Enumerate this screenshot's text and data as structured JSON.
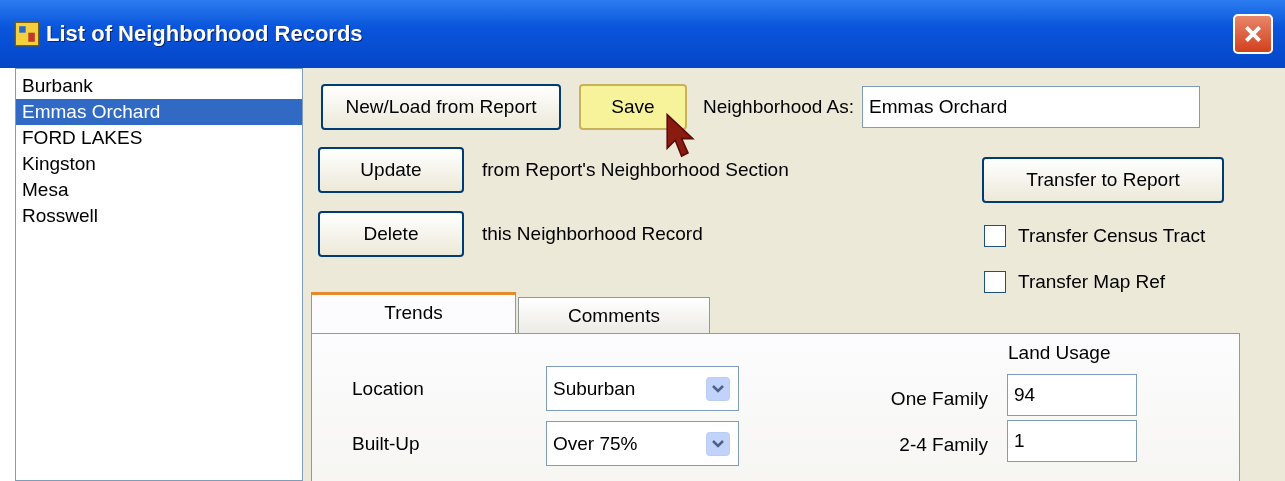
{
  "window": {
    "title": "List of Neighborhood Records"
  },
  "neighborhoods": [
    {
      "label": "Burbank",
      "selected": false
    },
    {
      "label": "Emmas Orchard",
      "selected": true
    },
    {
      "label": "FORD LAKES",
      "selected": false
    },
    {
      "label": "Kingston",
      "selected": false
    },
    {
      "label": "Mesa",
      "selected": false
    },
    {
      "label": "Rosswell",
      "selected": false
    }
  ],
  "top_row": {
    "load_button": "New/Load from Report",
    "save_button": {
      "label": "Save",
      "highlighted": true
    },
    "name_label": "Neighborhood As:",
    "name_value": "Emmas Orchard"
  },
  "actions": [
    {
      "button": "Update",
      "note": "from Report's Neighborhood Section"
    },
    {
      "button": "Delete",
      "note": "this Neighborhood Record"
    }
  ],
  "transfer_button": "Transfer to Report",
  "checkboxes": [
    {
      "label": "Transfer Census Tract",
      "checked": false
    },
    {
      "label": "Transfer Map Ref",
      "checked": false
    }
  ],
  "tabs": [
    {
      "label": "Trends",
      "selected": true
    },
    {
      "label": "Comments",
      "selected": false
    }
  ],
  "trends": [
    {
      "label": "Location",
      "value": "Suburban"
    },
    {
      "label": "Built-Up",
      "value": "Over 75%"
    }
  ],
  "land_usage": {
    "title": "Land Usage",
    "rows": [
      {
        "label": "One Family",
        "value": "94"
      },
      {
        "label": "2-4 Family",
        "value": "1"
      }
    ]
  }
}
